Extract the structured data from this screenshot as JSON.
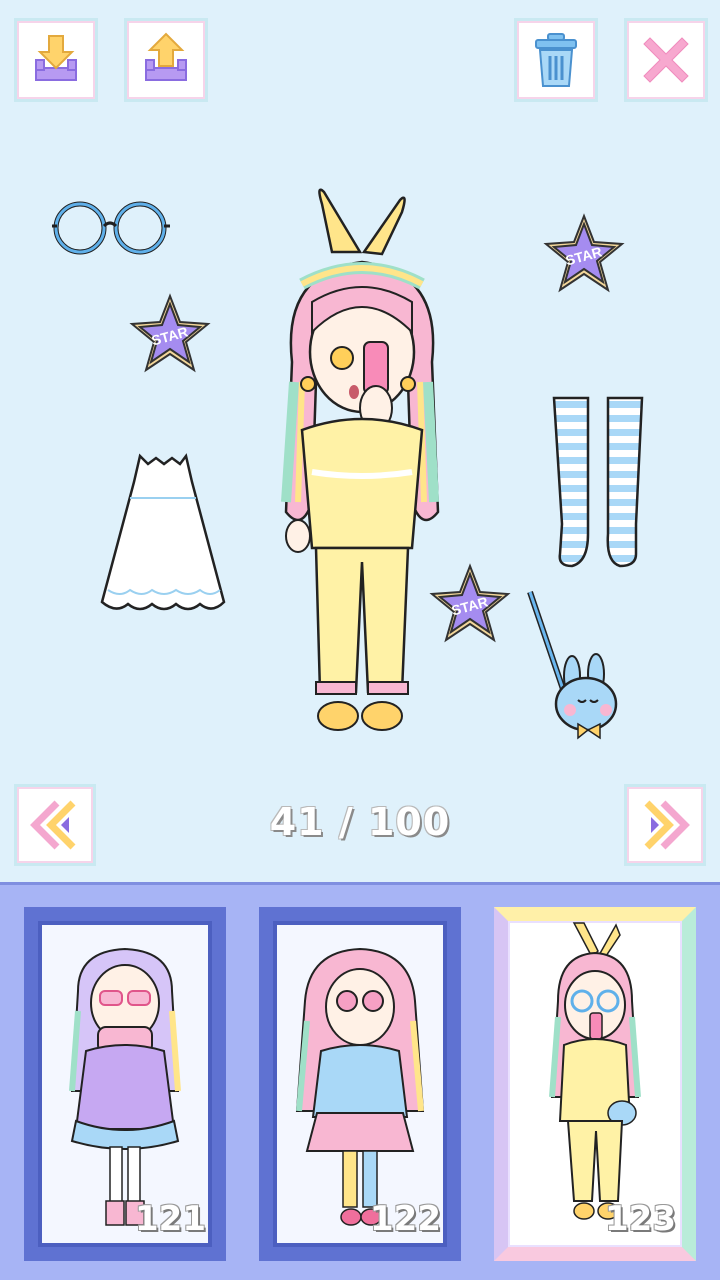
{
  "toolbar": {
    "download_icon": "download-icon",
    "upload_icon": "upload-icon",
    "trash_icon": "trash-icon",
    "close_icon": "close-icon"
  },
  "pager": {
    "current": 41,
    "total": 100,
    "label": "41 / 100"
  },
  "scene_items": [
    {
      "name": "round-glasses"
    },
    {
      "name": "star-cookie"
    },
    {
      "name": "white-dress"
    },
    {
      "name": "striped-stockings"
    },
    {
      "name": "bunny-bag"
    }
  ],
  "outfit_cards": [
    {
      "number": "121",
      "selected": false
    },
    {
      "number": "122",
      "selected": false
    },
    {
      "number": "123",
      "selected": true
    }
  ],
  "colors": {
    "background": "#dff1fb",
    "tray": "#a7b4f5",
    "card_frame": "#5f72d2",
    "star_purple": "#a58cf0",
    "yellow_outfit": "#fff2a6"
  }
}
